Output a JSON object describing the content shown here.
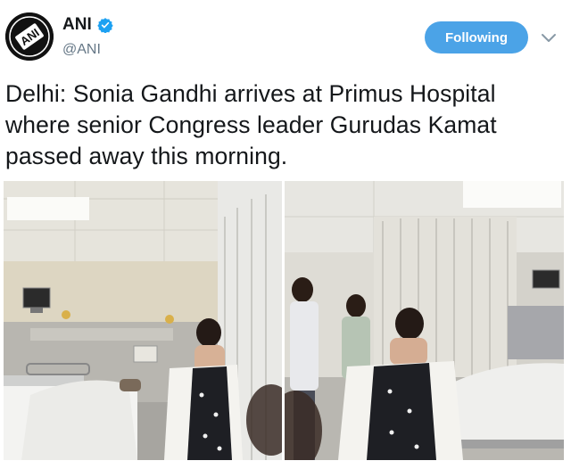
{
  "account": {
    "display_name": "ANI",
    "handle": "@ANI",
    "avatar_text": "ANI",
    "verified": true
  },
  "follow_button": {
    "label": "Following"
  },
  "tweet": {
    "text": "Delhi: Sonia Gandhi arrives at Primus Hospital where senior Congress leader Gurudas Kamat passed away this morning."
  },
  "photos": [
    {
      "icon": "hospital-room-photo-left"
    },
    {
      "icon": "hospital-room-photo-right"
    }
  ],
  "colors": {
    "accent": "#4ba3e7",
    "verified_badge": "#1da1f2",
    "text": "#14171a",
    "muted": "#657786"
  }
}
